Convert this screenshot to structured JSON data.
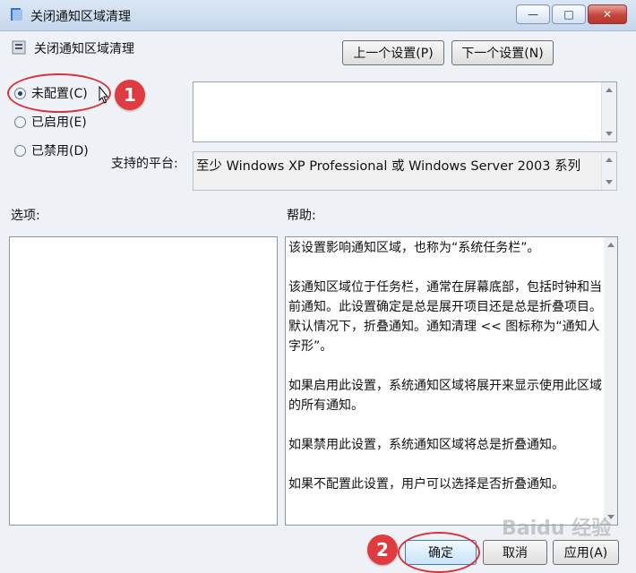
{
  "window": {
    "title": "关闭通知区域清理",
    "min_icon": "—",
    "max_icon": "□",
    "close_icon": "✕"
  },
  "header": {
    "setting_title": "关闭通知区域清理",
    "prev_button": "上一个设置(P)",
    "next_button": "下一个设置(N)"
  },
  "radios": [
    {
      "label": "未配置(C)",
      "checked": true
    },
    {
      "label": "已启用(E)",
      "checked": false
    },
    {
      "label": "已禁用(D)",
      "checked": false
    }
  ],
  "annotations": {
    "step1": "1",
    "step2": "2"
  },
  "platform": {
    "label": "支持的平台:",
    "value": "至少 Windows XP Professional 或 Windows Server 2003 系列"
  },
  "sections": {
    "options": "选项:",
    "help": "帮助:"
  },
  "help_text": "该设置影响通知区域，也称为“系统任务栏”。\n\n该通知区域位于任务栏，通常在屏幕底部，包括时钟和当前通知。此设置确定是总是展开项目还是总是折叠项目。默认情况下，折叠通知。通知清理 << 图标称为“通知人字形”。\n\n如果启用此设置，系统通知区域将展开来显示使用此区域的所有通知。\n\n如果禁用此设置，系统通知区域将总是折叠通知。\n\n如果不配置此设置，用户可以选择是否折叠通知。",
  "footer": {
    "ok": "确定",
    "cancel": "取消",
    "apply": "应用(A)"
  },
  "watermark": "Baidu 经验"
}
